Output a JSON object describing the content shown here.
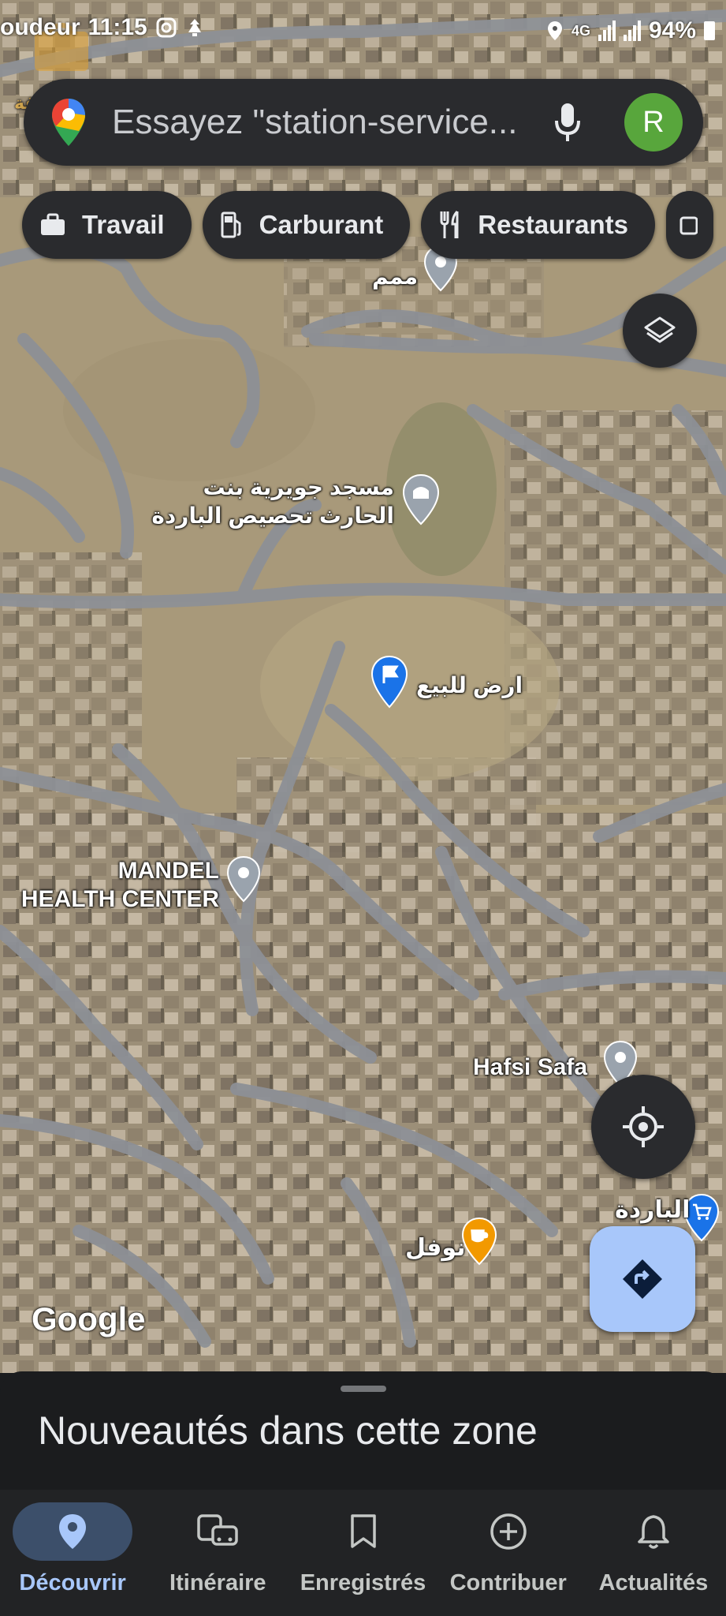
{
  "status_bar": {
    "time": "11:15",
    "left_fragment": "oudeur",
    "network": "4G",
    "battery": "94%",
    "icons": [
      "shopping-bag-icon",
      "instagram-icon",
      "notification-icon",
      "location-icon",
      "signal-icon",
      "battery-icon"
    ]
  },
  "search": {
    "placeholder": "Essayez \"station-service...",
    "avatar_letter": "R",
    "avatar_color": "#58a63c"
  },
  "chips": [
    {
      "label": "Travail",
      "icon": "briefcase-icon"
    },
    {
      "label": "Carburant",
      "icon": "gas-station-icon"
    },
    {
      "label": "Restaurants",
      "icon": "restaurant-icon"
    }
  ],
  "map": {
    "watermark": "Google",
    "overlay_logo_text": "سويقة",
    "places": {
      "mmm": "ممم",
      "mosque_line1": "مسجد جويرية بنت",
      "mosque_line2": "الحارث تحصيص الباردة",
      "land": "ارض للبيع",
      "health_line1": "MANDEL",
      "health_line2": "HEALTH CENTER",
      "hafsi": "Hafsi Safa",
      "cafe": "نوفل",
      "barda": "الباردة"
    }
  },
  "sheet": {
    "title": "Nouveautés dans cette zone"
  },
  "nav": [
    {
      "label": "Découvrir",
      "icon": "location-pin-icon",
      "active": true
    },
    {
      "label": "Itinéraire",
      "icon": "commute-icon",
      "active": false
    },
    {
      "label": "Enregistrés",
      "icon": "bookmark-icon",
      "active": false
    },
    {
      "label": "Contribuer",
      "icon": "add-circle-icon",
      "active": false
    },
    {
      "label": "Actualités",
      "icon": "bell-icon",
      "active": false
    }
  ],
  "colors": {
    "accent": "#a8c7fa",
    "surface": "#2a2b2e",
    "road": "#8d9096",
    "terrain": "#a39475"
  }
}
